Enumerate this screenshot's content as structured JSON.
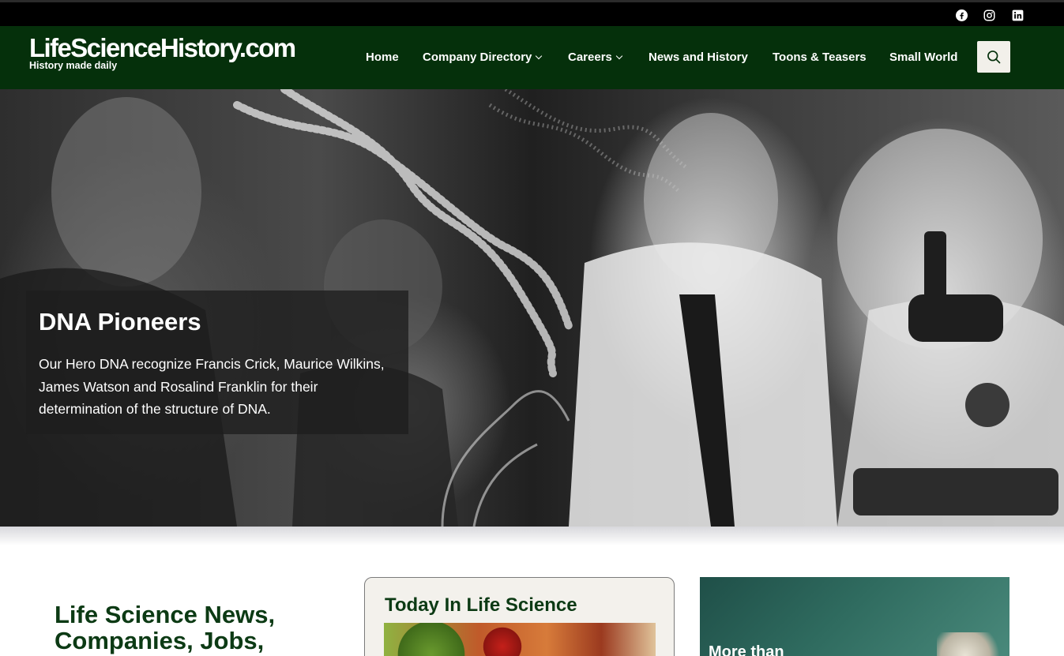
{
  "social": {
    "icons": [
      "facebook-icon",
      "instagram-icon",
      "linkedin-icon"
    ]
  },
  "header": {
    "logo_title": "LifeScienceHistory.com",
    "logo_tagline": "History made daily",
    "nav": [
      {
        "label": "Home",
        "has_dropdown": false
      },
      {
        "label": "Company Directory",
        "has_dropdown": true
      },
      {
        "label": "Careers",
        "has_dropdown": true
      },
      {
        "label": "News and History",
        "has_dropdown": false
      },
      {
        "label": "Toons & Teasers",
        "has_dropdown": false
      },
      {
        "label": "Small World",
        "has_dropdown": false
      }
    ],
    "search_icon": "search-icon"
  },
  "hero": {
    "title": "DNA Pioneers",
    "text": "Our Hero DNA recognize Francis Crick,  Maurice Wilkins, James Watson and Rosalind Franklin for their determination of the structure of DNA."
  },
  "main": {
    "heading": "Life Science News, Companies, Jobs,",
    "today_card_title": "Today In Life Science",
    "promo_text": "More than"
  },
  "colors": {
    "header_bg": "#05300b",
    "topbar_bg": "#000000",
    "heading_green": "#0c3a14",
    "card_bg": "#f3f1ec"
  }
}
